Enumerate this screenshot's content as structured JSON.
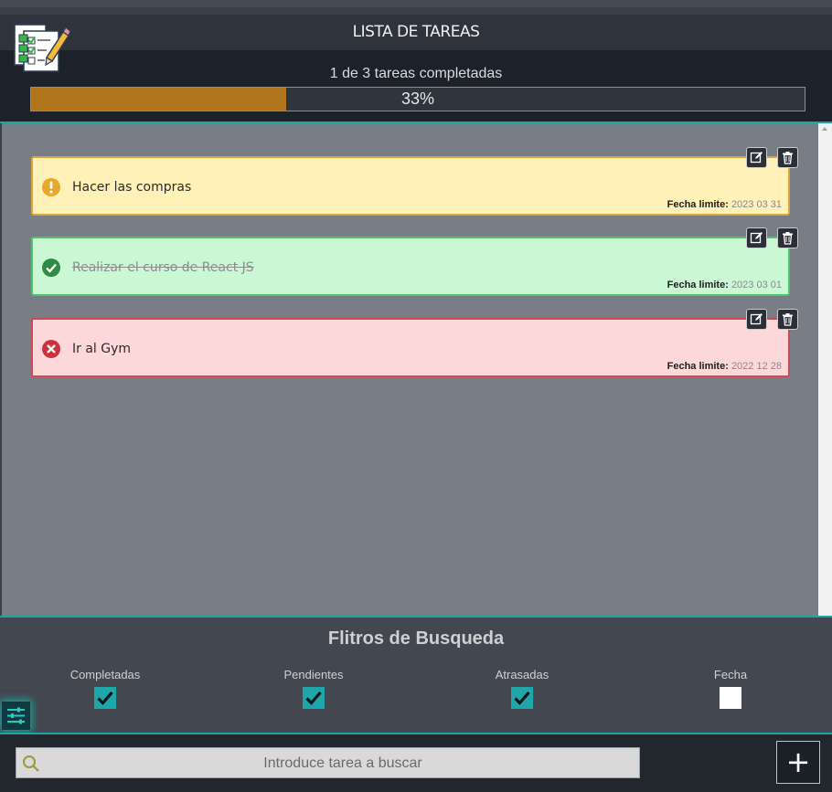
{
  "app": {
    "title": "LISTA DE TAREAS"
  },
  "progress": {
    "summary": "1 de 3 tareas completadas",
    "percent_label": "33%",
    "fraction": 0.33
  },
  "tasks": [
    {
      "text": "Hacer las compras",
      "status": "pending",
      "status_icon": "warning-icon",
      "date_label": "Fecha limite:",
      "date": "2023 03 31"
    },
    {
      "text": "Realizar el curso de React JS",
      "status": "completed",
      "status_icon": "check-circle-icon",
      "date_label": "Fecha limite:",
      "date": "2023 03 01"
    },
    {
      "text": "Ir al Gym",
      "status": "overdue",
      "status_icon": "error-circle-icon",
      "date_label": "Fecha limite:",
      "date": "2022 12 28"
    }
  ],
  "task_actions": {
    "edit_icon": "edit-icon",
    "delete_icon": "trash-icon"
  },
  "filters": {
    "title": "Flitros de Busqueda",
    "items": [
      {
        "label": "Completadas",
        "checked": true
      },
      {
        "label": "Pendientes",
        "checked": true
      },
      {
        "label": "Atrasadas",
        "checked": true
      },
      {
        "label": "Fecha",
        "checked": false
      }
    ]
  },
  "search": {
    "placeholder": "Introduce tarea a buscar",
    "value": ""
  },
  "add_button": {
    "label": "+"
  },
  "colors": {
    "accent": "#1aa7a1",
    "progress": "#b0741a",
    "pending_bg": "#fff1b7",
    "completed_bg": "#cbf8d4",
    "overdue_bg": "#fdd8da"
  }
}
